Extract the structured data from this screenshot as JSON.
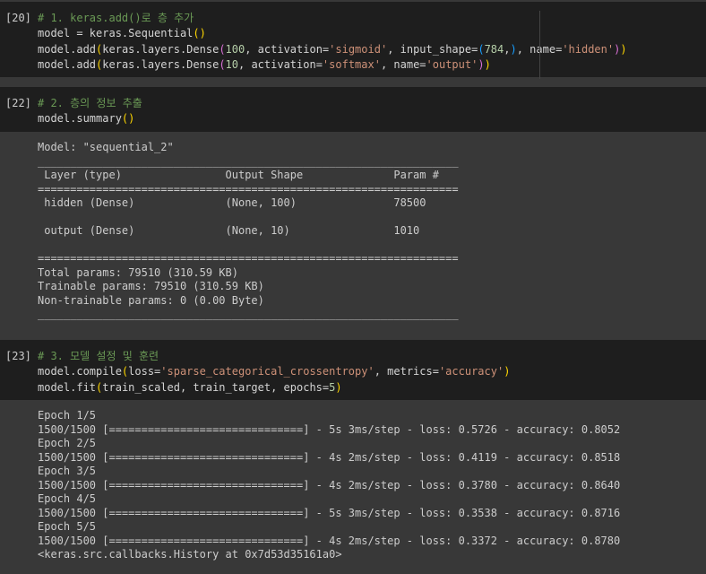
{
  "cells": [
    {
      "prompt": "[20]",
      "lines": [
        [
          {
            "t": "# 1. keras.add()로 층 추가",
            "c": "cm"
          }
        ],
        [
          {
            "t": "model = keras.Sequential",
            "c": ""
          },
          {
            "t": "()",
            "c": "p1"
          }
        ],
        [
          {
            "t": "model.add",
            "c": ""
          },
          {
            "t": "(",
            "c": "p1"
          },
          {
            "t": "keras.layers.Dense",
            "c": ""
          },
          {
            "t": "(",
            "c": "p2"
          },
          {
            "t": "100",
            "c": "num"
          },
          {
            "t": ", activation=",
            "c": ""
          },
          {
            "t": "'sigmoid'",
            "c": "str"
          },
          {
            "t": ", input_shape=",
            "c": ""
          },
          {
            "t": "(",
            "c": "p3"
          },
          {
            "t": "784",
            "c": "num"
          },
          {
            "t": ",",
            "c": ""
          },
          {
            "t": ")",
            "c": "p3"
          },
          {
            "t": ", name=",
            "c": ""
          },
          {
            "t": "'hidden'",
            "c": "str"
          },
          {
            "t": ")",
            "c": "p2"
          },
          {
            "t": ")",
            "c": "p1"
          }
        ],
        [
          {
            "t": "model.add",
            "c": ""
          },
          {
            "t": "(",
            "c": "p1"
          },
          {
            "t": "keras.layers.Dense",
            "c": ""
          },
          {
            "t": "(",
            "c": "p2"
          },
          {
            "t": "10",
            "c": "num"
          },
          {
            "t": ", activation=",
            "c": ""
          },
          {
            "t": "'softmax'",
            "c": "str"
          },
          {
            "t": ", name=",
            "c": ""
          },
          {
            "t": "'output'",
            "c": "str"
          },
          {
            "t": ")",
            "c": "p2"
          },
          {
            "t": ")",
            "c": "p1"
          }
        ]
      ]
    },
    {
      "prompt": "[22]",
      "lines": [
        [
          {
            "t": "# 2. 층의 정보 추출",
            "c": "cm"
          }
        ],
        [
          {
            "t": "model.summary",
            "c": ""
          },
          {
            "t": "()",
            "c": "p1"
          }
        ]
      ]
    },
    {
      "prompt": "[23]",
      "lines": [
        [
          {
            "t": "# 3. 모델 설정 및 훈련",
            "c": "cm"
          }
        ],
        [
          {
            "t": "model.compile",
            "c": ""
          },
          {
            "t": "(",
            "c": "p1"
          },
          {
            "t": "loss=",
            "c": ""
          },
          {
            "t": "'sparse_categorical_crossentropy'",
            "c": "str"
          },
          {
            "t": ", metrics=",
            "c": ""
          },
          {
            "t": "'accuracy'",
            "c": "str"
          },
          {
            "t": ")",
            "c": "p1"
          }
        ],
        [
          {
            "t": "model.fit",
            "c": ""
          },
          {
            "t": "(",
            "c": "p1"
          },
          {
            "t": "train_scaled, train_target, epochs=",
            "c": ""
          },
          {
            "t": "5",
            "c": "num"
          },
          {
            "t": ")",
            "c": "p1"
          }
        ]
      ]
    }
  ],
  "summary_output": [
    "Model: \"sequential_2\"",
    "_________________________________________________________________",
    " Layer (type)                Output Shape              Param #   ",
    "=================================================================",
    " hidden (Dense)              (None, 100)               78500     ",
    "",
    " output (Dense)              (None, 10)                1010      ",
    "",
    "=================================================================",
    "Total params: 79510 (310.59 KB)",
    "Trainable params: 79510 (310.59 KB)",
    "Non-trainable params: 0 (0.00 Byte)",
    "_________________________________________________________________"
  ],
  "fit_output": [
    "Epoch 1/5",
    "1500/1500 [==============================] - 5s 3ms/step - loss: 0.5726 - accuracy: 0.8052",
    "Epoch 2/5",
    "1500/1500 [==============================] - 4s 2ms/step - loss: 0.4119 - accuracy: 0.8518",
    "Epoch 3/5",
    "1500/1500 [==============================] - 4s 2ms/step - loss: 0.3780 - accuracy: 0.8640",
    "Epoch 4/5",
    "1500/1500 [==============================] - 5s 3ms/step - loss: 0.3538 - accuracy: 0.8716",
    "Epoch 5/5",
    "1500/1500 [==============================] - 4s 2ms/step - loss: 0.3372 - accuracy: 0.8780",
    "<keras.src.callbacks.History at 0x7d53d35161a0>"
  ]
}
